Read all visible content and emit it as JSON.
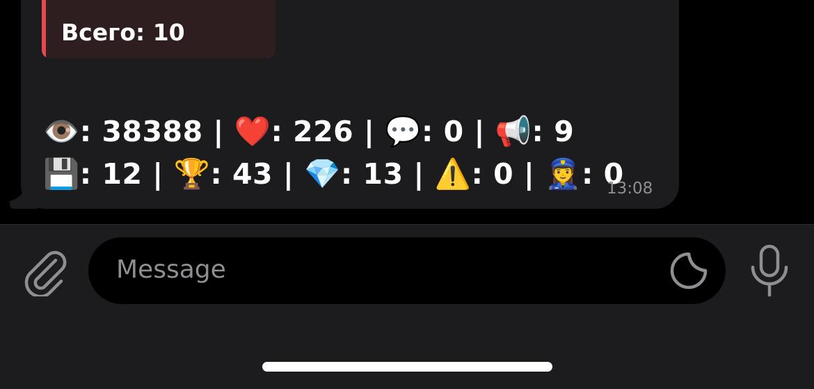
{
  "message": {
    "quote_text": "Всего: 10",
    "stats_line1": [
      {
        "icon": "👁️",
        "icon_name": "eye-icon",
        "value": ": 38388 | "
      },
      {
        "icon": "❤️",
        "icon_name": "heart-icon",
        "value": ": 226 | "
      },
      {
        "icon": "💬",
        "icon_name": "speech-bubble-icon",
        "value": ": 0 | "
      },
      {
        "icon": "📢",
        "icon_name": "loudspeaker-icon",
        "value": ": 9"
      }
    ],
    "stats_line2": [
      {
        "icon": "💾",
        "icon_name": "floppy-disk-icon",
        "value": ": 12 | "
      },
      {
        "icon": "🏆",
        "icon_name": "trophy-icon",
        "value": ": 43 | "
      },
      {
        "icon": "💎",
        "icon_name": "gem-icon",
        "value": ": 13 | "
      },
      {
        "icon": "⚠️",
        "icon_name": "warning-icon",
        "value": ": 0 | "
      },
      {
        "icon": "👮‍♀️",
        "icon_name": "police-officer-icon",
        "value": ": 0"
      }
    ],
    "timestamp": "13:08"
  },
  "composer": {
    "placeholder": "Message",
    "attach_icon": "paperclip-icon",
    "sticker_icon": "sticker-icon",
    "mic_icon": "microphone-icon"
  },
  "colors": {
    "bubble": "#1c1c1e",
    "quote_accent": "#e5484d",
    "quote_bg": "#2e1e1f",
    "muted_text": "#8e8e93"
  }
}
